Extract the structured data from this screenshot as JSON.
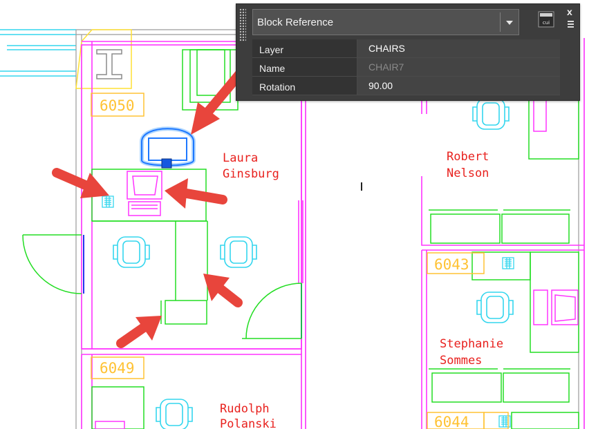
{
  "quick_properties": {
    "object_type": "Block Reference",
    "close_label": "x",
    "rows": [
      {
        "label": "Layer",
        "value": "CHAIRS"
      },
      {
        "label": "Name",
        "value": "CHAIR7"
      },
      {
        "label": "Rotation",
        "value": "90.00"
      }
    ]
  },
  "drawing": {
    "room_numbers": [
      "6050",
      "6049",
      "6043",
      "6044"
    ],
    "occupants": {
      "laura": [
        "Laura",
        "Ginsburg"
      ],
      "robert": [
        "Robert",
        "Nelson"
      ],
      "stephanie": [
        "Stephanie",
        "Sommes"
      ],
      "rudolph": [
        "Rudolph",
        "Polanski"
      ]
    }
  },
  "colors": {
    "walls": "#ff33ff",
    "furniture": "#22dd22",
    "chairs": "#33d6ee",
    "room_tags": "#ffc233",
    "names": "#e8211e",
    "selection": "#1e78ff",
    "arrows": "#e8453c",
    "panel_bg": "#3d3d3d"
  }
}
